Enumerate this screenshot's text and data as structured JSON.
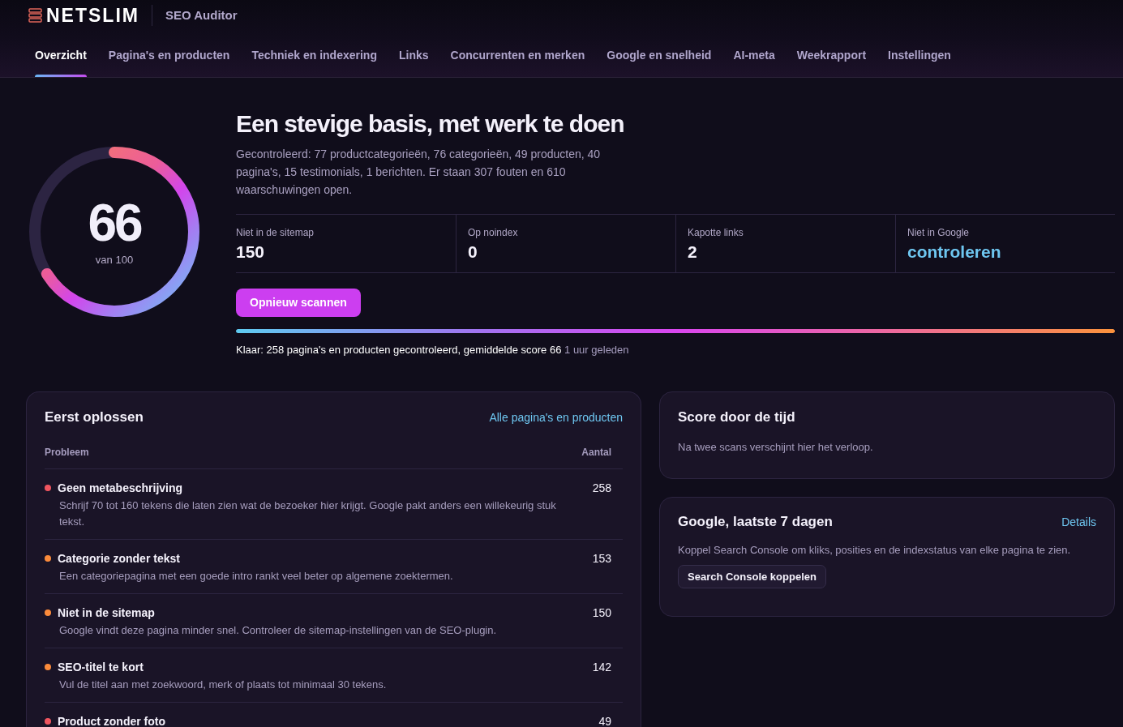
{
  "header": {
    "brand": "NETSLIM",
    "product": "SEO Auditor"
  },
  "tabs": [
    {
      "label": "Overzicht",
      "selected": true
    },
    {
      "label": "Pagina's en producten",
      "selected": false
    },
    {
      "label": "Techniek en indexering",
      "selected": false
    },
    {
      "label": "Links",
      "selected": false
    },
    {
      "label": "Concurrenten en merken",
      "selected": false
    },
    {
      "label": "Google en snelheid",
      "selected": false
    },
    {
      "label": "AI-meta",
      "selected": false
    },
    {
      "label": "Weekrapport",
      "selected": false
    },
    {
      "label": "Instellingen",
      "selected": false
    }
  ],
  "summary": {
    "score": {
      "value": "66",
      "caption": "van 100",
      "level": 0.66
    },
    "title": "Een stevige basis, met werk te doen",
    "description": "Gecontroleerd: 77 productcategorieën, 76 categorieën, 49 producten, 40 pagina's, 15 testimonials, 1 berichten. Er staan 307 fouten en 610 waarschuwingen open.",
    "stats": [
      {
        "label": "Niet in de sitemap",
        "value": "150",
        "kind": "number"
      },
      {
        "label": "Op noindex",
        "value": "0",
        "kind": "number"
      },
      {
        "label": "Kapotte links",
        "value": "2",
        "kind": "number"
      },
      {
        "label": "Niet in Google",
        "value": "controleren",
        "kind": "link"
      }
    ],
    "rescan_button": "Opnieuw scannen",
    "progress": {
      "level": 1
    },
    "status": {
      "text": "Klaar: 258 pagina's en producten gecontroleerd, gemiddelde score 66",
      "time": "1 uur geleden"
    }
  },
  "fix_first": {
    "title": "Eerst oplossen",
    "link": "Alle pagina's en producten",
    "columns": [
      "Probleem",
      "Aantal"
    ],
    "rows": [
      {
        "title": "Geen metabeschrijving",
        "description": "Schrijf 70 tot 160 tekens die laten zien wat de bezoeker hier krijgt. Google pakt anders een willekeurig stuk tekst.",
        "count": "258",
        "color": "#f0555f"
      },
      {
        "title": "Categorie zonder tekst",
        "description": "Een categoriepagina met een goede intro rankt veel beter op algemene zoektermen.",
        "count": "153",
        "color": "#fb8b3b"
      },
      {
        "title": "Niet in de sitemap",
        "description": "Google vindt deze pagina minder snel. Controleer de sitemap-instellingen van de SEO-plugin.",
        "count": "150",
        "color": "#fb8b3b"
      },
      {
        "title": "SEO-titel te kort",
        "description": "Vul de titel aan met zoekwoord, merk of plaats tot minimaal 30 tekens.",
        "count": "142",
        "color": "#fb8b3b"
      },
      {
        "title": "Product zonder foto",
        "count": "49",
        "color": "#f0555f"
      }
    ]
  },
  "score_history": {
    "title": "Score door de tijd",
    "text": "Na twee scans verschijnt hier het verloop."
  },
  "google": {
    "title": "Google, laatste 7 dagen",
    "link": "Details",
    "text": "Koppel Search Console om kliks, posities en de indexstatus van elke pagina te zien.",
    "button": "Search Console koppelen"
  }
}
